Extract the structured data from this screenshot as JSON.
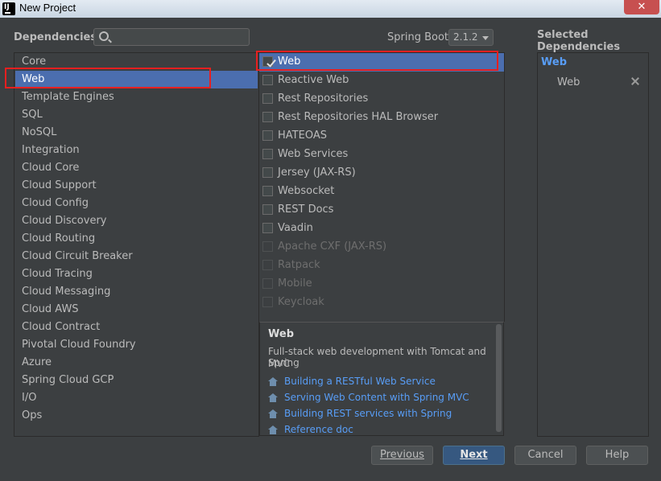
{
  "window": {
    "title": "New Project",
    "app_icon": "intellij-icon",
    "app_icon_text": "IJ",
    "close_glyph": "✕"
  },
  "header": {
    "dependencies_label": "Dependencies",
    "search_placeholder": "",
    "spring_boot_label": "Spring Boot",
    "spring_boot_version": "2.1.2"
  },
  "categories": [
    {
      "label": "Core",
      "selected": false
    },
    {
      "label": "Web",
      "selected": true
    },
    {
      "label": "Template Engines",
      "selected": false
    },
    {
      "label": "SQL",
      "selected": false
    },
    {
      "label": "NoSQL",
      "selected": false
    },
    {
      "label": "Integration",
      "selected": false
    },
    {
      "label": "Cloud Core",
      "selected": false
    },
    {
      "label": "Cloud Support",
      "selected": false
    },
    {
      "label": "Cloud Config",
      "selected": false
    },
    {
      "label": "Cloud Discovery",
      "selected": false
    },
    {
      "label": "Cloud Routing",
      "selected": false
    },
    {
      "label": "Cloud Circuit Breaker",
      "selected": false
    },
    {
      "label": "Cloud Tracing",
      "selected": false
    },
    {
      "label": "Cloud Messaging",
      "selected": false
    },
    {
      "label": "Cloud AWS",
      "selected": false
    },
    {
      "label": "Cloud Contract",
      "selected": false
    },
    {
      "label": "Pivotal Cloud Foundry",
      "selected": false
    },
    {
      "label": "Azure",
      "selected": false
    },
    {
      "label": "Spring Cloud GCP",
      "selected": false
    },
    {
      "label": "I/O",
      "selected": false
    },
    {
      "label": "Ops",
      "selected": false
    }
  ],
  "dependencies": [
    {
      "label": "Web",
      "checked": true,
      "enabled": true,
      "selected": true
    },
    {
      "label": "Reactive Web",
      "checked": false,
      "enabled": true,
      "selected": false
    },
    {
      "label": "Rest Repositories",
      "checked": false,
      "enabled": true,
      "selected": false
    },
    {
      "label": "Rest Repositories HAL Browser",
      "checked": false,
      "enabled": true,
      "selected": false
    },
    {
      "label": "HATEOAS",
      "checked": false,
      "enabled": true,
      "selected": false
    },
    {
      "label": "Web Services",
      "checked": false,
      "enabled": true,
      "selected": false
    },
    {
      "label": "Jersey (JAX-RS)",
      "checked": false,
      "enabled": true,
      "selected": false
    },
    {
      "label": "Websocket",
      "checked": false,
      "enabled": true,
      "selected": false
    },
    {
      "label": "REST Docs",
      "checked": false,
      "enabled": true,
      "selected": false
    },
    {
      "label": "Vaadin",
      "checked": false,
      "enabled": true,
      "selected": false
    },
    {
      "label": "Apache CXF (JAX-RS)",
      "checked": false,
      "enabled": false,
      "selected": false
    },
    {
      "label": "Ratpack",
      "checked": false,
      "enabled": false,
      "selected": false
    },
    {
      "label": "Mobile",
      "checked": false,
      "enabled": false,
      "selected": false
    },
    {
      "label": "Keycloak",
      "checked": false,
      "enabled": false,
      "selected": false
    }
  ],
  "description": {
    "title": "Web",
    "text_line1": "Full-stack web development with Tomcat and Spring",
    "text_line2": "MVC",
    "links": [
      {
        "label": "Building a RESTful Web Service",
        "icon": "home-icon"
      },
      {
        "label": "Serving Web Content with Spring MVC",
        "icon": "home-icon"
      },
      {
        "label": "Building REST services with Spring",
        "icon": "home-icon"
      },
      {
        "label": "Reference doc",
        "icon": "home-icon"
      }
    ]
  },
  "selected_panel": {
    "title": "Selected Dependencies",
    "group": "Web",
    "items": [
      {
        "label": "Web",
        "remove_icon": "close-icon"
      }
    ]
  },
  "buttons": {
    "previous": "Previous",
    "next": "Next",
    "cancel": "Cancel",
    "help": "Help"
  },
  "colors": {
    "background": "#3c3f41",
    "selection": "#4b6eaf",
    "link": "#589df6",
    "highlight_box": "#e81f1f"
  }
}
